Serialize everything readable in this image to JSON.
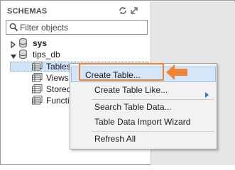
{
  "panel": {
    "title": "SCHEMAS"
  },
  "filter": {
    "placeholder": "Filter objects"
  },
  "tree": {
    "sys": "sys",
    "tips_db": "tips_db",
    "tables": "Tables",
    "views": "Views",
    "stored": "Stored",
    "functions": "Functi"
  },
  "context_menu": {
    "items": [
      {
        "label": "Create Table..."
      },
      {
        "label": "Create Table Like..."
      },
      {
        "label": "Search Table Data..."
      },
      {
        "label": "Table Data Import Wizard"
      },
      {
        "label": "Refresh All"
      }
    ]
  },
  "colors": {
    "highlight": "#f08431",
    "selection": "#cfe4f7"
  },
  "icons": [
    "refresh-icon",
    "collapse-icon",
    "search-icon",
    "database-icon",
    "table-folder-icon",
    "submenu-arrow-icon",
    "pointer-arrow-icon"
  ]
}
